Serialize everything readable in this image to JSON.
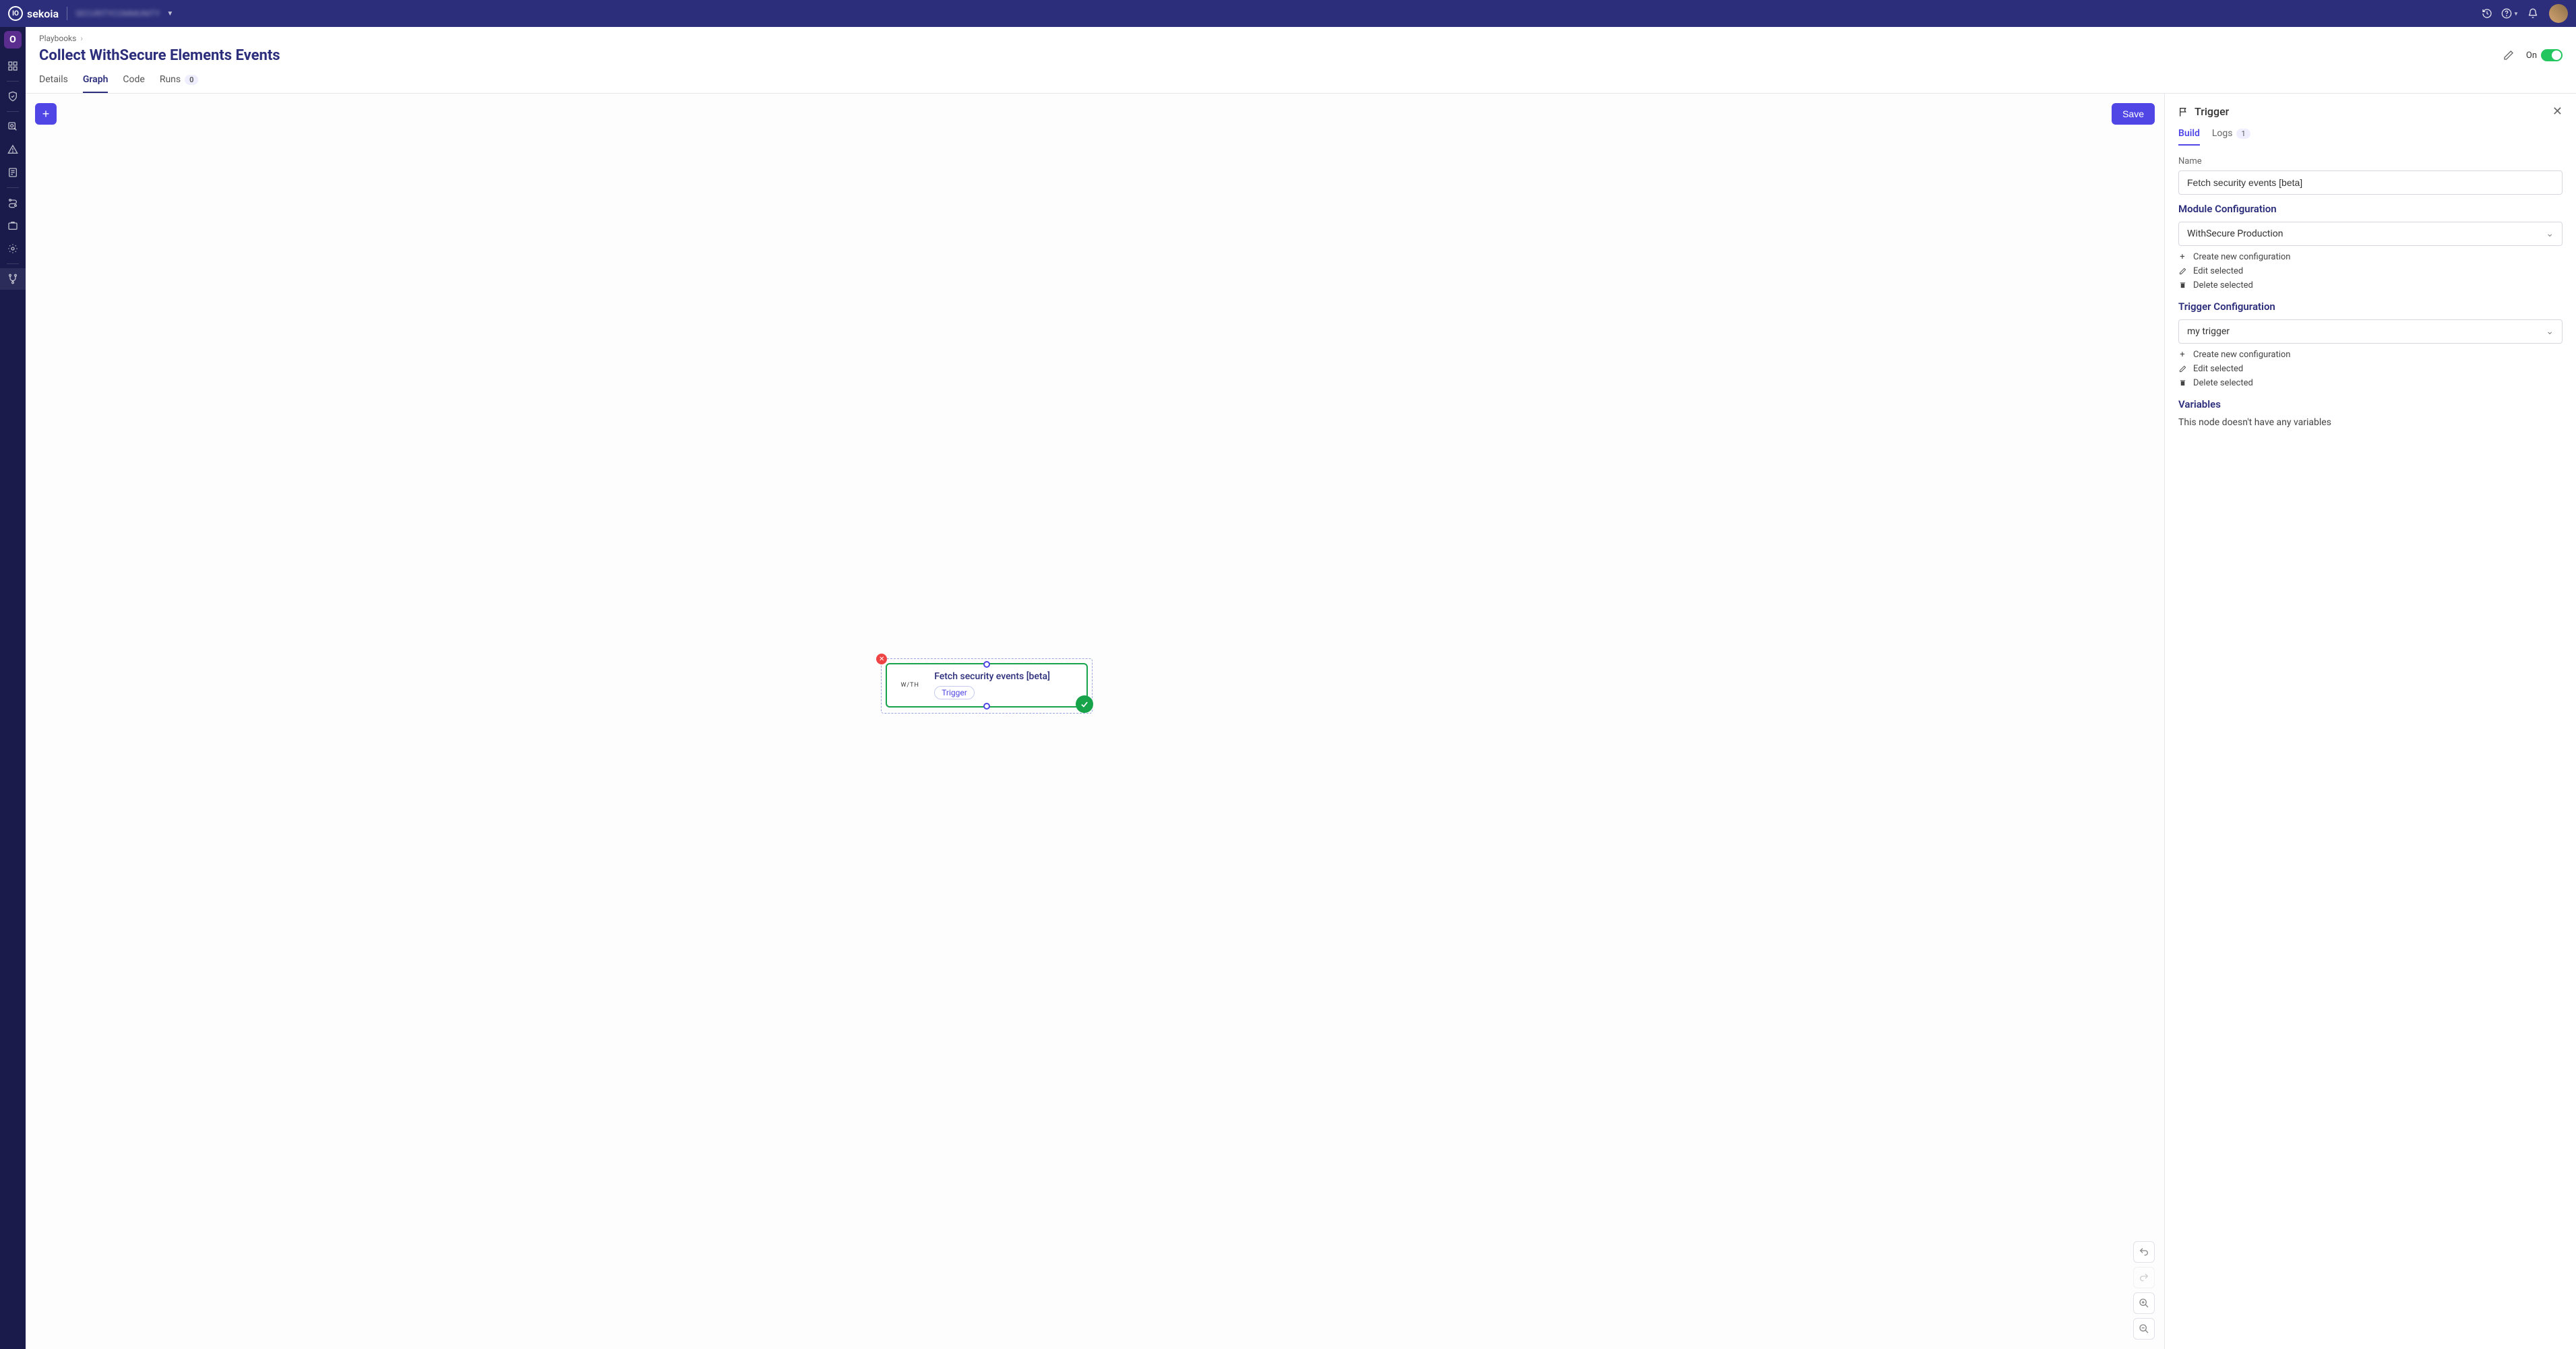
{
  "header": {
    "brand": "sekoia",
    "community_placeholder": "SECURITYCOMMUNITY"
  },
  "sidebar": {
    "badge": "O"
  },
  "breadcrumb": {
    "root": "Playbooks"
  },
  "page": {
    "title": "Collect WithSecure Elements Events",
    "toggle_label": "On"
  },
  "tabs": {
    "details": "Details",
    "graph": "Graph",
    "code": "Code",
    "runs": "Runs",
    "runs_count": "0"
  },
  "canvas": {
    "save": "Save",
    "node": {
      "icon_label": "W/TH",
      "title": "Fetch security events [beta]",
      "tag": "Trigger"
    }
  },
  "inspector": {
    "title": "Trigger",
    "tabs": {
      "build": "Build",
      "logs": "Logs",
      "logs_count": "1"
    },
    "name_label": "Name",
    "name_value": "Fetch security events [beta]",
    "module_config": {
      "heading": "Module Configuration",
      "selected": "WithSecure Production",
      "actions": {
        "create": "Create new configuration",
        "edit": "Edit selected",
        "delete": "Delete selected"
      }
    },
    "trigger_config": {
      "heading": "Trigger Configuration",
      "selected": "my trigger",
      "actions": {
        "create": "Create new configuration",
        "edit": "Edit selected",
        "delete": "Delete selected"
      }
    },
    "variables": {
      "heading": "Variables",
      "empty": "This node doesn't have any variables"
    }
  }
}
